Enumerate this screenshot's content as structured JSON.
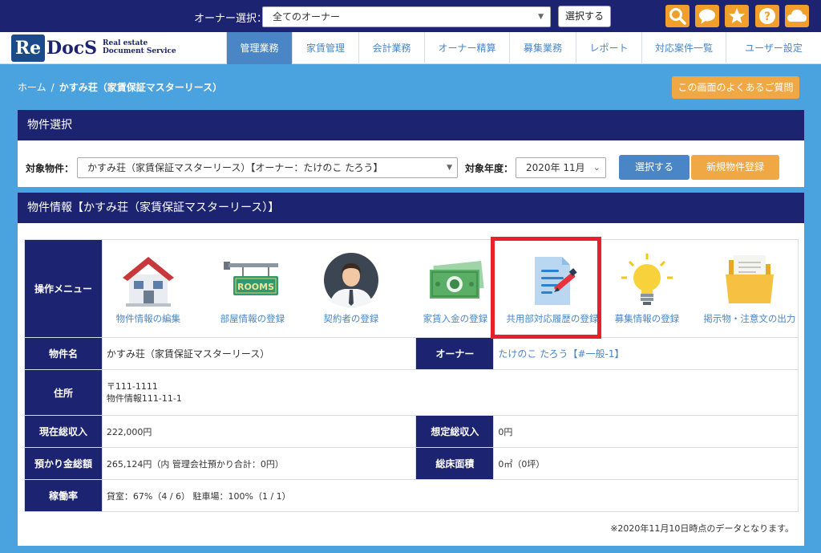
{
  "topbar": {
    "owner_label": "オーナー選択：",
    "owner_selected": "全てのオーナー",
    "select_button": "選択する",
    "icons": [
      "search-icon",
      "chat-icon",
      "star-icon",
      "help-icon",
      "cloud-icon"
    ],
    "accent": "#f0a02a"
  },
  "logo": {
    "re": "Re",
    "docs": "DocS",
    "sub1": "Real estate",
    "sub2": "Document Service"
  },
  "nav": [
    {
      "label": "管理業務",
      "active": true
    },
    {
      "label": "家賃管理"
    },
    {
      "label": "会計業務"
    },
    {
      "label": "オーナー精算"
    },
    {
      "label": "募集業務"
    },
    {
      "label": "レポート"
    },
    {
      "label": "対応案件一覧"
    },
    {
      "label": "ユーザー設定"
    }
  ],
  "breadcrumb": {
    "home": "ホーム",
    "sep": "/",
    "current": "かすみ荘（家賃保証マスターリース）"
  },
  "faq_button": "この画面のよくあるご質問",
  "property_select": {
    "title": "物件選択",
    "property_label": "対象物件：",
    "property_value": "かすみ荘（家賃保証マスターリース）【オーナー：たけのこ たろう】",
    "year_label": "対象年度：",
    "year_value": "2020年 11月",
    "select_button": "選択する",
    "new_button": "新規物件登録"
  },
  "property_info": {
    "title": "物件情報【かすみ荘（家賃保証マスターリース）】",
    "menu_label": "操作メニュー",
    "menu": [
      {
        "label": "物件情報の編集",
        "icon": "house-icon"
      },
      {
        "label": "部屋情報の登録",
        "icon": "rooms-sign-icon"
      },
      {
        "label": "契約者の登録",
        "icon": "person-icon"
      },
      {
        "label": "家賃入金の登録",
        "icon": "money-icon"
      },
      {
        "label": "共用部対応履歴の登録",
        "icon": "document-pen-icon"
      },
      {
        "label": "募集情報の登録",
        "icon": "lightbulb-icon"
      },
      {
        "label": "掲示物・注意文の出力",
        "icon": "folder-icon"
      }
    ],
    "rooms_sign_text": "ROOMS",
    "rows": {
      "name_label": "物件名",
      "name_value": "かすみ荘（家賃保証マスターリース）",
      "owner_label": "オーナー",
      "owner_value": "たけのこ たろう【#一般-1】",
      "address_label": "住所",
      "address_line1": "〒111-1111",
      "address_line2": "物件情報111-11-1",
      "income_label": "現在総収入",
      "income_value": "222,000円",
      "expected_label": "想定総収入",
      "expected_value": "0円",
      "deposit_label": "預かり金総額",
      "deposit_value": "265,124円（内 管理会社預かり合計：0円）",
      "floor_label": "総床面積",
      "floor_value": "0㎡（0坪）",
      "occupancy_label": "稼働率",
      "occupancy_value": "貸室：67%（4 / 6） 駐車場：100%（1 / 1）"
    },
    "footnote": "※2020年11月10日時点のデータとなります。"
  }
}
